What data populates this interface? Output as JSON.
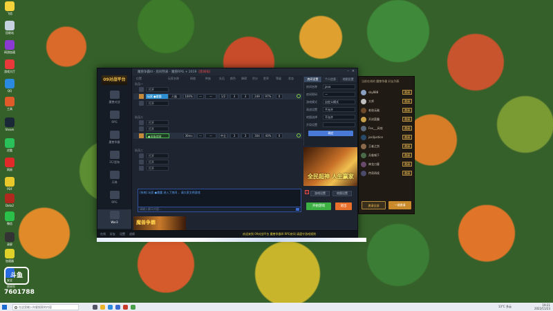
{
  "desktop": {
    "icons": [
      {
        "label": "飞信",
        "color": "#f5d33a"
      },
      {
        "label": "回收站",
        "color": "#c7d2e0"
      },
      {
        "label": "网游加速",
        "color": "#8a3ad0"
      },
      {
        "label": "游戏大厅",
        "color": "#e83a3a"
      },
      {
        "label": "QQ",
        "color": "#2a8ae0"
      },
      {
        "label": "工具",
        "color": "#e05a2a"
      },
      {
        "label": "Steam",
        "color": "#1b2838"
      },
      {
        "label": "优酷",
        "color": "#2ac05a"
      },
      {
        "label": "网易",
        "color": "#e02a2a"
      },
      {
        "label": "PDF",
        "color": "#e8c82a"
      },
      {
        "label": "Dota2",
        "color": "#b0281e"
      },
      {
        "label": "微信",
        "color": "#2ac04a"
      },
      {
        "label": "录屏",
        "color": "#333333"
      },
      {
        "label": "加速器",
        "color": "#e0d02a"
      },
      {
        "label": "安全",
        "color": "#2a6ae0"
      }
    ]
  },
  "window": {
    "title": "魔兽争霸III - 房间列表 - 魔兽RPG + 2019",
    "title_red": "[房间号]",
    "logo": "09对战平台",
    "nav": [
      "魔兽对战",
      "RPG",
      "魔兽争霸",
      "3C/澄海",
      "天梯",
      "RPG",
      "War3"
    ],
    "bottom_strip": [
      "在线",
      "好友",
      "设置",
      "战绩"
    ],
    "news": "欢迎来到 09对战平台 魔兽争霸III RPG房间 请遵守游戏规则"
  },
  "grid": {
    "headers": [
      "位置",
      "玩家名称",
      "网络",
      "种族",
      "队伍",
      "颜色",
      "障碍",
      "积分",
      "胜率",
      "等级",
      "状态"
    ],
    "teams": [
      {
        "name": "队伍一",
        "rows": [
          {
            "type": "slot",
            "value": "打开"
          },
          {
            "type": "player",
            "name": "玩家 ●雷霆",
            "cells": [
              "人族",
              "100%",
              "—",
              "—",
              "1/2",
              "3",
              "3",
              "249",
              "97%",
              "0"
            ],
            "style": "blue"
          },
          {
            "type": "slot",
            "value": "打开"
          }
        ]
      },
      {
        "name": "队伍二",
        "rows": [
          {
            "type": "slot",
            "value": "打开"
          },
          {
            "type": "slot",
            "value": "打开"
          },
          {
            "type": "player",
            "name": "●准备就绪",
            "cells": [
              "30ms",
              "—",
              "—",
              "中立",
              "3",
              "3",
              "304",
              "40%",
              "0"
            ],
            "style": "green"
          }
        ]
      },
      {
        "name": "队伍三",
        "rows": [
          {
            "type": "slot",
            "value": "打开"
          },
          {
            "type": "slot",
            "value": "打开"
          },
          {
            "type": "slot",
            "value": "打开"
          }
        ]
      }
    ]
  },
  "chat": {
    "message": "[系统] 玩家 ●雷霆 进入了房间 ，请大家文明游戏",
    "placeholder": "请输入聊天内容..."
  },
  "game_banner": "魔兽争霸",
  "right_panel": {
    "tabs": [
      "房间设置",
      "个人信息",
      "地图设置"
    ],
    "fields": [
      {
        "label": "房间名称",
        "value": "java"
      },
      {
        "label": "房间密码",
        "value": "—"
      },
      {
        "label": "游戏模式",
        "value": "自定义模式"
      },
      {
        "label": "观战设置",
        "value": "不允许"
      },
      {
        "label": "地图选择",
        "value": "不允许"
      },
      {
        "label": "开局设置",
        "value": ""
      }
    ],
    "button": "确定"
  },
  "ad": {
    "text": "全民超神 人生赢家"
  },
  "ready_panel": {
    "close": "×",
    "btn_a": "游戏设置",
    "btn_b": "地图设置",
    "btn_start": "开始游戏",
    "btn_quit": "退出"
  },
  "side_panel": {
    "title": "当前在线的 魔兽争霸 好友列表",
    "friends": [
      {
        "name": "sky888",
        "action": "邀请",
        "color": "#8aa0c0"
      },
      {
        "name": "大师",
        "action": "邀请",
        "color": "#c0c0c0"
      },
      {
        "name": "老爸无敌",
        "action": "邀请",
        "color": "#6a4a2a"
      },
      {
        "name": "开封菜霸",
        "action": "邀请",
        "color": "#c8a04a"
      },
      {
        "name": "Fox___码农",
        "action": "邀请",
        "color": "#5a6a7a"
      },
      {
        "name": "josiljustice",
        "action": "邀请",
        "color": "#2a4a6a"
      },
      {
        "name": "王者之剑",
        "action": "邀请",
        "color": "#8a6a4a"
      },
      {
        "name": "兵临城下",
        "action": "邀请",
        "color": "#4a6a4a"
      },
      {
        "name": "神龙刀客",
        "action": "邀请",
        "color": "#6a4a6a"
      },
      {
        "name": "传奇再续",
        "action": "邀请",
        "color": "#4a4a6a"
      }
    ],
    "btn_left": "邀请全部",
    "btn_right": "一键邀请"
  },
  "taskbar": {
    "search_placeholder": "在这里输入你要搜索的内容",
    "temp": "13°C 多云",
    "time": "19:21",
    "date": "2022/11/23"
  },
  "watermark": {
    "logo": "斗鱼",
    "sub": "房间号",
    "number": "7601788"
  },
  "colors": {
    "accent_blue": "#2d8fd0",
    "start_green": "#3cb043",
    "quit_orange": "#e8702a",
    "gold": "#f0c050"
  }
}
